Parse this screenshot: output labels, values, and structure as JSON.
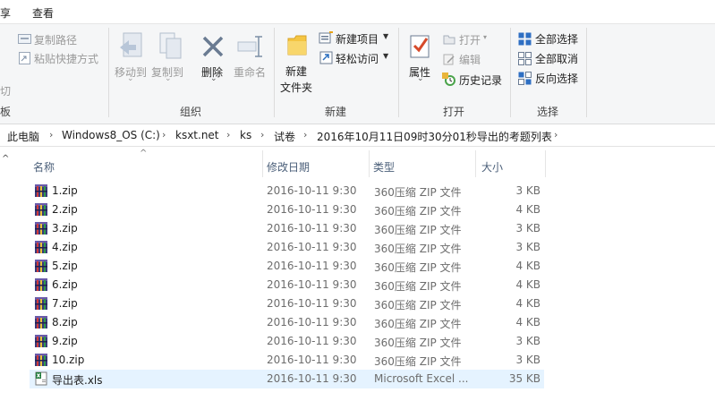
{
  "menubar": {
    "share": "享",
    "view": "查看"
  },
  "ribbon": {
    "clipboard": {
      "copy_path": "复制路径",
      "paste_shortcut": "粘贴快捷方式",
      "cut_fragment": "切",
      "group_fragment": "板"
    },
    "organize": {
      "move_to": "移动到",
      "copy_to": "复制到",
      "delete": "删除",
      "rename": "重命名",
      "group": "组织"
    },
    "new": {
      "new_folder_line1": "新建",
      "new_folder_line2": "文件夹",
      "new_item": "新建项目",
      "easy_access": "轻松访问",
      "group": "新建"
    },
    "open": {
      "properties": "属性",
      "open": "打开",
      "edit": "编辑",
      "history": "历史记录",
      "group": "打开"
    },
    "select": {
      "select_all": "全部选择",
      "select_none": "全部取消",
      "invert": "反向选择",
      "group": "选择"
    }
  },
  "breadcrumb": [
    "此电脑",
    "Windows8_OS (C:)",
    "ksxt.net",
    "ks",
    "试卷",
    "2016年10月11日09时30分01秒导出的考题列表"
  ],
  "columns": {
    "name": "名称",
    "date": "修改日期",
    "type": "类型",
    "size": "大小"
  },
  "files": [
    {
      "name": "1.zip",
      "date": "2016-10-11 9:30",
      "type": "360压缩 ZIP 文件",
      "size": "3 KB",
      "kind": "zip"
    },
    {
      "name": "2.zip",
      "date": "2016-10-11 9:30",
      "type": "360压缩 ZIP 文件",
      "size": "4 KB",
      "kind": "zip"
    },
    {
      "name": "3.zip",
      "date": "2016-10-11 9:30",
      "type": "360压缩 ZIP 文件",
      "size": "3 KB",
      "kind": "zip"
    },
    {
      "name": "4.zip",
      "date": "2016-10-11 9:30",
      "type": "360压缩 ZIP 文件",
      "size": "3 KB",
      "kind": "zip"
    },
    {
      "name": "5.zip",
      "date": "2016-10-11 9:30",
      "type": "360压缩 ZIP 文件",
      "size": "4 KB",
      "kind": "zip"
    },
    {
      "name": "6.zip",
      "date": "2016-10-11 9:30",
      "type": "360压缩 ZIP 文件",
      "size": "4 KB",
      "kind": "zip"
    },
    {
      "name": "7.zip",
      "date": "2016-10-11 9:30",
      "type": "360压缩 ZIP 文件",
      "size": "4 KB",
      "kind": "zip"
    },
    {
      "name": "8.zip",
      "date": "2016-10-11 9:30",
      "type": "360压缩 ZIP 文件",
      "size": "4 KB",
      "kind": "zip"
    },
    {
      "name": "9.zip",
      "date": "2016-10-11 9:30",
      "type": "360压缩 ZIP 文件",
      "size": "3 KB",
      "kind": "zip"
    },
    {
      "name": "10.zip",
      "date": "2016-10-11 9:30",
      "type": "360压缩 ZIP 文件",
      "size": "3 KB",
      "kind": "zip"
    },
    {
      "name": "导出表.xls",
      "date": "2016-10-11 9:30",
      "type": "Microsoft Excel ...",
      "size": "35 KB",
      "kind": "excel",
      "selected": true
    }
  ],
  "colors": {
    "selection": "#e5f3ff",
    "header_text": "#4c607a",
    "accent_blue": "#1a73c9"
  }
}
